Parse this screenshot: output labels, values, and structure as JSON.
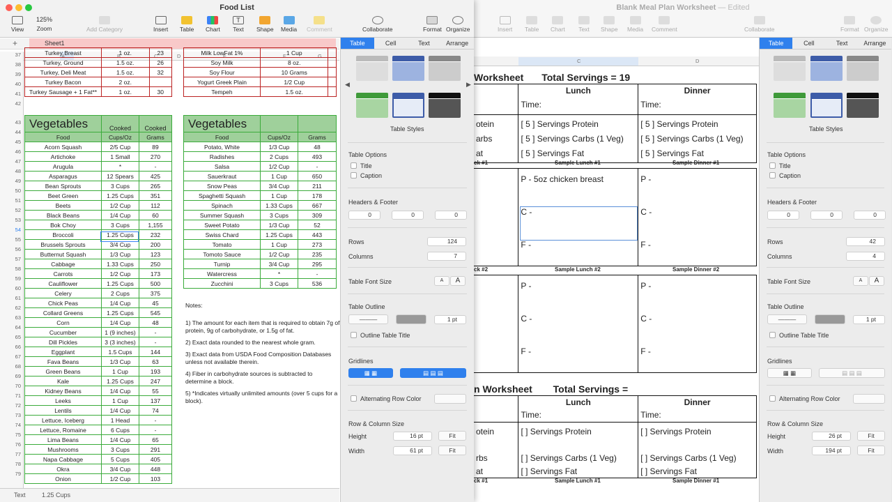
{
  "left_window": {
    "title": "Food List",
    "sheet_tab": "Sheet1",
    "status_label": "Text",
    "status_value": "1.25 Cups",
    "zoom": "125%"
  },
  "toolbar": {
    "view": "View",
    "zoom": "Zoom",
    "add_category": "Add Category",
    "insert": "Insert",
    "table": "Table",
    "chart": "Chart",
    "text": "Text",
    "shape": "Shape",
    "media": "Media",
    "comment": "Comment",
    "collaborate": "Collaborate",
    "format": "Format",
    "organize": "Organize"
  },
  "right_window": {
    "title": "Blank Meal Plan Worksheet",
    "edited": "— Edited"
  },
  "columns": [
    "A",
    "B",
    "C",
    "D",
    "E",
    "F",
    "G"
  ],
  "right_columns": [
    "C",
    "D"
  ],
  "row_numbers": [
    "37",
    "38",
    "39",
    "40",
    "41",
    "42",
    "43",
    "44",
    "45",
    "46",
    "47",
    "48",
    "49",
    "50",
    "51",
    "52",
    "53",
    "54",
    "55",
    "56",
    "57",
    "58",
    "59",
    "60",
    "61",
    "62",
    "63",
    "64",
    "65",
    "66",
    "67",
    "68",
    "69",
    "70",
    "71",
    "72",
    "73",
    "74",
    "75",
    "76",
    "77",
    "78",
    "79"
  ],
  "top_left_rows": [
    [
      "Turkey Breast",
      "1 oz.",
      "23"
    ],
    [
      "Turkey, Ground",
      "1.5 oz.",
      "26"
    ],
    [
      "Turkey, Deli Meat",
      "1.5 oz.",
      "32"
    ],
    [
      "Turkey Bacon",
      "2 oz.",
      ""
    ],
    [
      "Turkey Sausage + 1 Fat**",
      "1 oz.",
      "30"
    ]
  ],
  "top_right_rows": [
    [
      "Milk LowFat 1%",
      "1 Cup",
      ""
    ],
    [
      "Soy Milk",
      "8 oz.",
      ""
    ],
    [
      "Soy Flour",
      "10 Grams",
      ""
    ],
    [
      "Yogurt Greek Plain",
      "1/2 Cup",
      ""
    ],
    [
      "Tempeh",
      "1.5 oz.",
      ""
    ]
  ],
  "veg_title": "Vegetables",
  "veg_headers_left": [
    "Food",
    "Cups/Oz",
    "Grams"
  ],
  "veg_headers_left_top": [
    "Cooked",
    "Cooked"
  ],
  "veg_headers_right": [
    "Food",
    "Cups/Oz",
    "Grams"
  ],
  "veg_left": [
    [
      "Acorn Squash",
      "2/5 Cup",
      "89"
    ],
    [
      "Artichoke",
      "1 Small",
      "270"
    ],
    [
      "Arugula",
      "*",
      "-"
    ],
    [
      "Asparagus",
      "12 Spears",
      "425"
    ],
    [
      "Bean Sprouts",
      "3 Cups",
      "265"
    ],
    [
      "Beet Green",
      "1.25 Cups",
      "351"
    ],
    [
      "Beets",
      "1/2 Cup",
      "112"
    ],
    [
      "Black Beans",
      "1/4 Cup",
      "60"
    ],
    [
      "Bok Choy",
      "3 Cups",
      "1,155"
    ],
    [
      "Broccoli",
      "1.25 Cups",
      "232"
    ],
    [
      "Brussels Sprouts",
      "3/4 Cup",
      "200"
    ],
    [
      "Butternut Squash",
      "1/3 Cup",
      "123"
    ],
    [
      "Cabbage",
      "1.33 Cups",
      "250"
    ],
    [
      "Carrots",
      "1/2 Cup",
      "173"
    ],
    [
      "Cauliflower",
      "1.25 Cups",
      "500"
    ],
    [
      "Celery",
      "2 Cups",
      "375"
    ],
    [
      "Chick Peas",
      "1/4 Cup",
      "45"
    ],
    [
      "Collard Greens",
      "1.25 Cups",
      "545"
    ],
    [
      "Corn",
      "1/4 Cup",
      "48"
    ],
    [
      "Cucumber",
      "1 (9 inches)",
      "-"
    ],
    [
      "Dill Pickles",
      "3 (3 inches)",
      "-"
    ],
    [
      "Eggplant",
      "1.5 Cups",
      "144"
    ],
    [
      "Fava Beans",
      "1/3 Cup",
      "63"
    ],
    [
      "Green Beans",
      "1 Cup",
      "193"
    ],
    [
      "Kale",
      "1.25 Cups",
      "247"
    ],
    [
      "Kidney Beans",
      "1/4 Cup",
      "55"
    ],
    [
      "Leeks",
      "1 Cup",
      "137"
    ],
    [
      "Lentils",
      "1/4 Cup",
      "74"
    ],
    [
      "Lettuce, Iceberg",
      "1 Head",
      "-"
    ],
    [
      "Lettuce, Romaine",
      "6 Cups",
      "-"
    ],
    [
      "Lima Beans",
      "1/4 Cup",
      "65"
    ],
    [
      "Mushrooms",
      "3 Cups",
      "291"
    ],
    [
      "Napa Cabbage",
      "5 Cups",
      "405"
    ],
    [
      "Okra",
      "3/4 Cup",
      "448"
    ],
    [
      "Onion",
      "1/2 Cup",
      "103"
    ]
  ],
  "veg_right": [
    [
      "Potato, White",
      "1/3 Cup",
      "48"
    ],
    [
      "Radishes",
      "2 Cups",
      "493"
    ],
    [
      "Salsa",
      "1/2 Cup",
      "-"
    ],
    [
      "Sauerkraut",
      "1 Cup",
      "650"
    ],
    [
      "Snow Peas",
      "3/4 Cup",
      "211"
    ],
    [
      "Spaghetti Squash",
      "1 Cup",
      "178"
    ],
    [
      "Spinach",
      "1.33 Cups",
      "667"
    ],
    [
      "Summer Squash",
      "3 Cups",
      "309"
    ],
    [
      "Sweet Potato",
      "1/3 Cup",
      "52"
    ],
    [
      "Swiss Chard",
      "1.25 Cups",
      "443"
    ],
    [
      "Tomato",
      "1 Cup",
      "273"
    ],
    [
      "Tomoto Sauce",
      "1/2 Cup",
      "235"
    ],
    [
      "Turnip",
      "3/4 Cup",
      "295"
    ],
    [
      "Watercress",
      "*",
      "-"
    ],
    [
      "Zucchini",
      "3 Cups",
      "536"
    ]
  ],
  "notes": [
    "Notes:",
    "1) The amount for each item that is required to obtain 7g of protein, 9g of carbohydrate, or 1.5g of fat.",
    "2) Exact data rounded to the nearest whole gram.",
    "3) Exact data from USDA Food Composition Databases unless not available therein.",
    "4) Fiber in carbohydrate sources is subtracted to determine a block.",
    "5) *Indicates virtually unlimited amounts (over 5 cups for a block)."
  ],
  "panel_left": {
    "tabs": [
      "Table",
      "Cell",
      "Text",
      "Arrange"
    ],
    "table_styles": "Table Styles",
    "table_options": "Table Options",
    "title": "Title",
    "caption": "Caption",
    "headers_footer": "Headers & Footer",
    "hf_values": [
      "0",
      "0",
      "0"
    ],
    "rows_label": "Rows",
    "rows": "124",
    "columns_label": "Columns",
    "columns": "7",
    "font_size": "Table Font Size",
    "font_small": "A",
    "font_large": "A",
    "outline": "Table Outline",
    "outline_pt": "1 pt",
    "outline_title": "Outline Table Title",
    "gridlines": "Gridlines",
    "alt_row": "Alternating Row Color",
    "row_col_size": "Row & Column Size",
    "height_label": "Height",
    "height": "16 pt",
    "width_label": "Width",
    "width": "61 pt",
    "fit": "Fit"
  },
  "panel_right": {
    "tabs": [
      "Table",
      "Cell",
      "Text",
      "Arrange"
    ],
    "table_styles": "Table Styles",
    "table_options": "Table Options",
    "title": "Title",
    "caption": "Caption",
    "headers_footer": "Headers & Footer",
    "hf_values": [
      "0",
      "0",
      "0"
    ],
    "rows_label": "Rows",
    "rows": "42",
    "columns_label": "Columns",
    "columns": "4",
    "font_size": "Table Font Size",
    "font_small": "A",
    "font_large": "A",
    "outline": "Table Outline",
    "outline_pt": "1 pt",
    "outline_title": "Outline Table Title",
    "gridlines": "Gridlines",
    "alt_row": "Alternating Row Color",
    "row_col_size": "Row & Column Size",
    "height_label": "Height",
    "height": "26 pt",
    "width_label": "Width",
    "width": "194 pt",
    "fit": "Fit"
  },
  "worksheet": {
    "w1_title": "Worksheet",
    "w1_servings": "Total Servings = 19",
    "lunch": "Lunch",
    "dinner": "Dinner",
    "time": "Time:",
    "w1_left_frag": [
      "otein",
      "arbs",
      "at"
    ],
    "w1_lunch": [
      "[  5  ] Servings Protein",
      "[  5  ] Servings Carbs (1 Veg)",
      "[  5  ] Servings Fat"
    ],
    "w1_dinner": [
      "[  5  ] Servings Protein",
      "[  5  ] Servings Carbs (1 Veg)",
      "[  5  ] Servings Fat"
    ],
    "sample1": [
      "ck #1",
      "Sample Lunch #1",
      "Sample Dinner #1"
    ],
    "s1_lunch": [
      "P - 5oz chicken breast",
      "C -",
      "F -"
    ],
    "s1_dinner": [
      "P -",
      "C -",
      "F -"
    ],
    "sample2": [
      "ck #2",
      "Sample Lunch #2",
      "Sample Dinner #2"
    ],
    "s2_lunch": [
      "P -",
      "C -",
      "F -"
    ],
    "s2_dinner": [
      "P -",
      "C -",
      "F -"
    ],
    "w2_title": "n Worksheet",
    "w2_servings": "Total Servings =",
    "w2_left_frag": [
      "otein",
      "rbs",
      "at"
    ],
    "w2_lunch": [
      "[    ] Servings Protein",
      "[    ] Servings Carbs (1 Veg)",
      "[    ] Servings Fat"
    ],
    "w2_dinner": [
      "[    ] Servings Protein",
      "[    ] Servings Carbs (1 Veg)",
      "[    ] Servings Fat"
    ],
    "sample3": [
      "ck #1",
      "Sample Lunch #1",
      "Sample Dinner #1"
    ]
  }
}
